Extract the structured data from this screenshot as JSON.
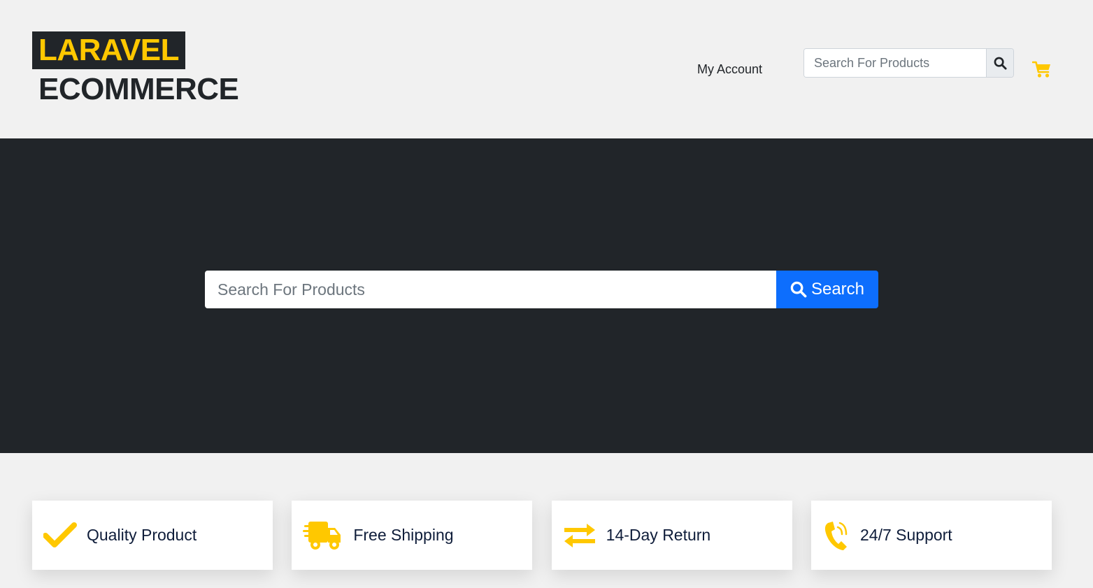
{
  "header": {
    "logo_line1": "LARAVEL",
    "logo_line2": "ECOMMERCE",
    "my_account": "My Account",
    "search_placeholder": "Search For Products"
  },
  "hero": {
    "search_placeholder": "Search For Products",
    "search_button": "Search"
  },
  "features": [
    {
      "label": "Quality Product",
      "icon": "check-icon"
    },
    {
      "label": "Free Shipping",
      "icon": "truck-icon"
    },
    {
      "label": "14-Day Return",
      "icon": "exchange-icon"
    },
    {
      "label": "24/7 Support",
      "icon": "phone-icon"
    }
  ],
  "colors": {
    "accent": "#ffc800",
    "dark": "#212529",
    "primary": "#0d6efd",
    "background": "#f1f1f1"
  }
}
